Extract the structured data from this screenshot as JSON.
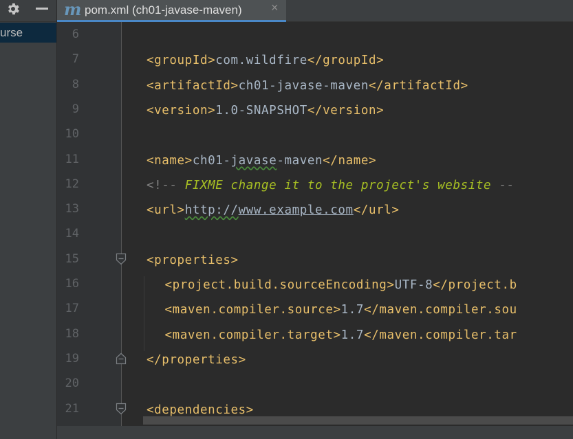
{
  "left_panel": {
    "selected_item": "urse"
  },
  "tab": {
    "icon_letter": "m",
    "title": "pom.xml (ch01-javase-maven)",
    "close_glyph": "×"
  },
  "editor": {
    "lines": [
      {
        "num": "6"
      },
      {
        "num": "7",
        "indent": 0,
        "segments": [
          {
            "t": "<groupId>",
            "c": "tag"
          },
          {
            "t": "com.wildfire",
            "c": "text"
          },
          {
            "t": "</groupId>",
            "c": "tag"
          }
        ]
      },
      {
        "num": "8",
        "indent": 0,
        "segments": [
          {
            "t": "<artifactId>",
            "c": "tag"
          },
          {
            "t": "ch01-javase-maven",
            "c": "text"
          },
          {
            "t": "</artifactId>",
            "c": "tag"
          }
        ]
      },
      {
        "num": "9",
        "indent": 0,
        "segments": [
          {
            "t": "<version>",
            "c": "tag"
          },
          {
            "t": "1.0-SNAPSHOT",
            "c": "text"
          },
          {
            "t": "</version>",
            "c": "tag"
          }
        ]
      },
      {
        "num": "10"
      },
      {
        "num": "11",
        "indent": 0,
        "segments": [
          {
            "t": "<name>",
            "c": "tag"
          },
          {
            "t": "ch01-",
            "c": "text"
          },
          {
            "t": "javase",
            "c": "text squiggle"
          },
          {
            "t": "-maven",
            "c": "text"
          },
          {
            "t": "</name>",
            "c": "tag"
          }
        ]
      },
      {
        "num": "12",
        "indent": 0,
        "segments": [
          {
            "t": "<!-- ",
            "c": "comment"
          },
          {
            "t": "FIXME change it to the project's website",
            "c": "todo"
          },
          {
            "t": " --",
            "c": "comment"
          }
        ]
      },
      {
        "num": "13",
        "indent": 0,
        "segments": [
          {
            "t": "<url>",
            "c": "tag"
          },
          {
            "t": "http://",
            "c": "link squiggle-link"
          },
          {
            "t": "www.example.com",
            "c": "link"
          },
          {
            "t": "</url>",
            "c": "tag"
          }
        ]
      },
      {
        "num": "14"
      },
      {
        "num": "15",
        "indent": 0,
        "fold": "open",
        "segments": [
          {
            "t": "<properties>",
            "c": "tag"
          }
        ]
      },
      {
        "num": "16",
        "indent": 1,
        "segments": [
          {
            "t": "<project.build.sourceEncoding>",
            "c": "tag"
          },
          {
            "t": "UTF-8",
            "c": "text"
          },
          {
            "t": "</project.b",
            "c": "tag"
          }
        ]
      },
      {
        "num": "17",
        "indent": 1,
        "segments": [
          {
            "t": "<maven.compiler.source>",
            "c": "tag"
          },
          {
            "t": "1.7",
            "c": "text"
          },
          {
            "t": "</maven.compiler.sou",
            "c": "tag"
          }
        ]
      },
      {
        "num": "18",
        "indent": 1,
        "segments": [
          {
            "t": "<maven.compiler.target>",
            "c": "tag"
          },
          {
            "t": "1.7",
            "c": "text"
          },
          {
            "t": "</maven.compiler.tar",
            "c": "tag"
          }
        ]
      },
      {
        "num": "19",
        "indent": 0,
        "fold": "close",
        "segments": [
          {
            "t": "</properties>",
            "c": "tag"
          }
        ]
      },
      {
        "num": "20"
      },
      {
        "num": "21",
        "indent": 0,
        "fold": "open",
        "segments": [
          {
            "t": "<dependencies>",
            "c": "tag"
          }
        ]
      }
    ]
  },
  "colors": {
    "tag": "#e8bf6a",
    "text": "#a9b7c6",
    "comment": "#808080",
    "todo": "#a8c023",
    "line_number": "#606366",
    "background": "#2b2b2b",
    "gutter": "#313335",
    "accent": "#4a88c7"
  },
  "icons": {
    "settings": "gear-icon",
    "minimize": "minimize-icon",
    "file_type": "maven-file-icon",
    "close": "close-icon"
  }
}
